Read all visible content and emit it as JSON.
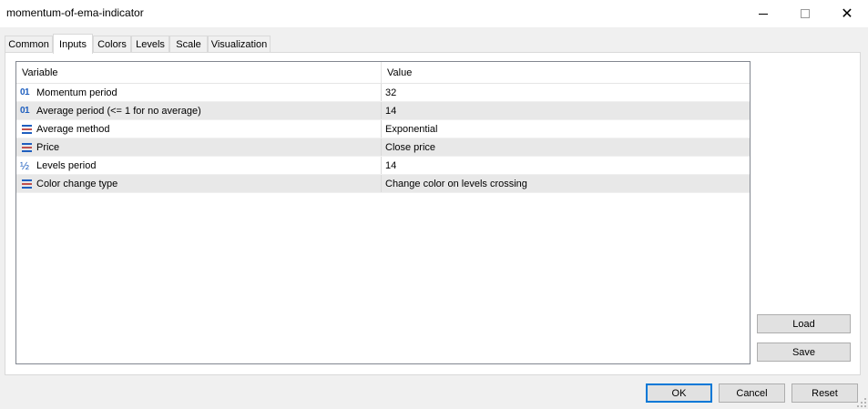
{
  "window": {
    "title": "momentum-of-ema-indicator",
    "controls": {
      "minimize_icon": "minimize-icon",
      "maximize_icon": "maximize-icon",
      "close_icon": "close-icon",
      "close_glyph": "✕"
    }
  },
  "tabs": [
    {
      "label": "Common",
      "active": false
    },
    {
      "label": "Inputs",
      "active": true
    },
    {
      "label": "Colors",
      "active": false
    },
    {
      "label": "Levels",
      "active": false
    },
    {
      "label": "Scale",
      "active": false
    },
    {
      "label": "Visualization",
      "active": false
    }
  ],
  "grid": {
    "columns": {
      "variable": "Variable",
      "value": "Value"
    },
    "rows": [
      {
        "icon": "integer-type-icon",
        "icon_glyph": "01",
        "variable": "Momentum period",
        "value": "32"
      },
      {
        "icon": "integer-type-icon",
        "icon_glyph": "01",
        "variable": "Average period (<= 1 for no average)",
        "value": "14"
      },
      {
        "icon": "enum-type-icon",
        "variable": "Average method",
        "value": "Exponential"
      },
      {
        "icon": "enum-type-icon",
        "variable": "Price",
        "value": "Close price"
      },
      {
        "icon": "fraction-type-icon",
        "icon_glyph": "½",
        "variable": "Levels period",
        "value": "14"
      },
      {
        "icon": "enum-type-icon",
        "variable": "Color change type",
        "value": "Change color on levels crossing"
      }
    ]
  },
  "side_buttons": {
    "load": "Load",
    "save": "Save"
  },
  "footer_buttons": {
    "ok": "OK",
    "cancel": "Cancel",
    "reset": "Reset"
  },
  "colors": {
    "accent": "#0078d7",
    "row_alt": "#e8e8e8",
    "type_icon_blue": "#1f5fbf",
    "enum_icon_red": "#c0504d"
  }
}
